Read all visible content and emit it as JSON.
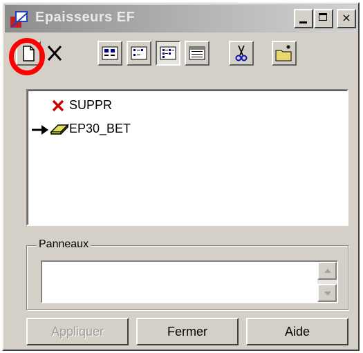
{
  "window": {
    "title": "Epaisseurs EF",
    "controls": {
      "minimize": "_",
      "maximize": "□",
      "close": "×"
    }
  },
  "toolbar": {
    "tools": [
      {
        "name": "new-document-icon",
        "selected": false
      },
      {
        "name": "delete-icon",
        "selected": false
      },
      {
        "name": "view-large-icons-icon",
        "selected": false
      },
      {
        "name": "view-small-icons-icon",
        "selected": false
      },
      {
        "name": "view-list-icon",
        "selected": true
      },
      {
        "name": "view-details-icon",
        "selected": false
      },
      {
        "name": "cut-icon",
        "selected": false
      },
      {
        "name": "folder-new-icon",
        "selected": false
      }
    ],
    "highlight_color": "#ff0000"
  },
  "list": {
    "items": [
      {
        "label": "SUPPR",
        "icon": "red-x-icon",
        "current": false
      },
      {
        "label": "EP30_BET",
        "icon": "eraser-icon",
        "current": true
      }
    ]
  },
  "panneaux": {
    "title": "Panneaux",
    "value": ""
  },
  "buttons": {
    "apply": "Appliquer",
    "close": "Fermer",
    "help": "Aide"
  }
}
